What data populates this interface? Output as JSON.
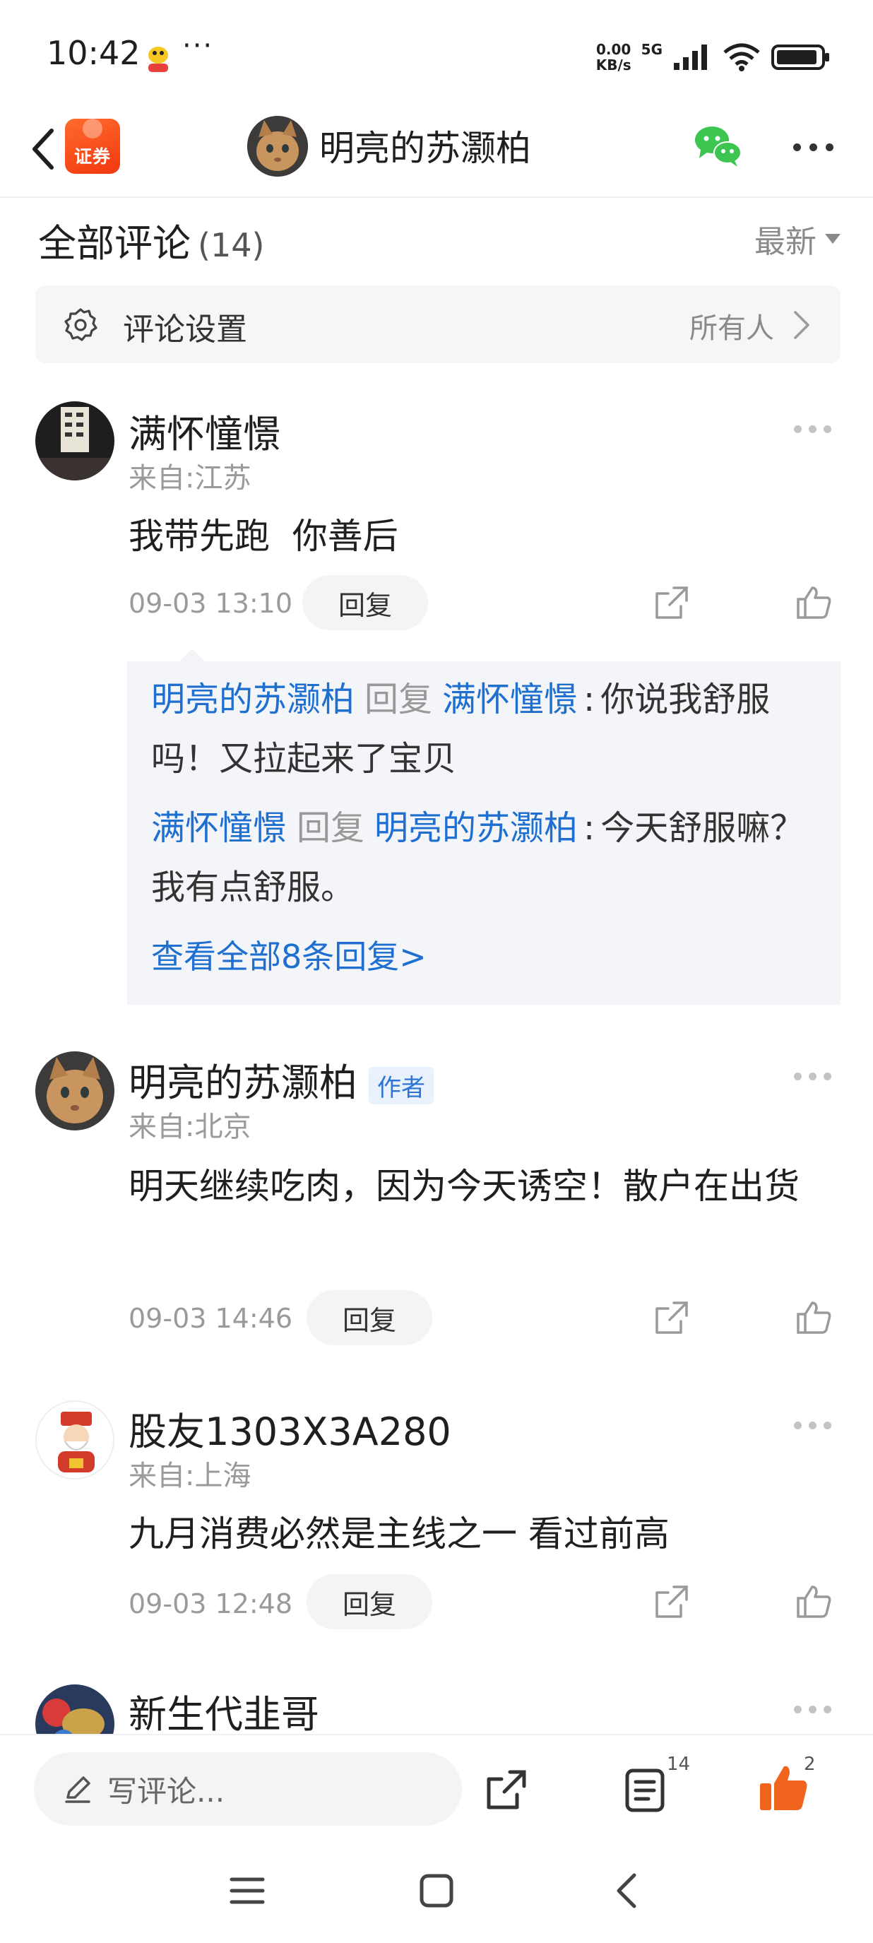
{
  "status_bar": {
    "time": "10:42",
    "app_icon": "yellow-duck-app-icon",
    "more": "···",
    "net_speed_value": "0.00",
    "net_speed_unit": "KB/s",
    "network": "5G"
  },
  "header": {
    "badge_label": "证券",
    "title": "明亮的苏灏柏",
    "icons": [
      "back-icon",
      "wechat-icon",
      "more-icon"
    ]
  },
  "comments_section": {
    "title": "全部评论",
    "count": "(14)",
    "sort_label": "最新"
  },
  "settings": {
    "label": "评论设置",
    "value": "所有人"
  },
  "comments": [
    {
      "name": "满怀憧憬",
      "location": "来自:江苏",
      "text": "我带先跑  你善后",
      "time": "09-03 13:10",
      "reply_label": "回复",
      "replies": [
        {
          "from": "明亮的苏灏柏",
          "verb": "回复",
          "to": "满怀憧憬",
          "colon": ":",
          "text": "你说我舒服吗！又拉起来了宝贝"
        },
        {
          "from": "满怀憧憬",
          "verb": "回复",
          "to": "明亮的苏灏柏",
          "colon": ":",
          "text": "今天舒服嘛？我有点舒服。"
        }
      ],
      "view_all": "查看全部8条回复>"
    },
    {
      "name": "明亮的苏灏柏",
      "author_tag": "作者",
      "location": "来自:北京",
      "text": "明天继续吃肉，因为今天诱空！散户在出货",
      "time": "09-03 14:46",
      "reply_label": "回复"
    },
    {
      "name": "股友1303X3A280",
      "location": "来自:上海",
      "text": "九月消费必然是主线之一 看过前高",
      "time": "09-03 12:48",
      "reply_label": "回复"
    },
    {
      "name": "新生代韭哥"
    }
  ],
  "bottom_bar": {
    "input_placeholder": "写评论...",
    "comment_count": "14",
    "like_count": "2"
  },
  "colors": {
    "link_blue": "#1f6fd1",
    "like_orange": "#f0641e",
    "badge_orange": "#f2380f"
  }
}
